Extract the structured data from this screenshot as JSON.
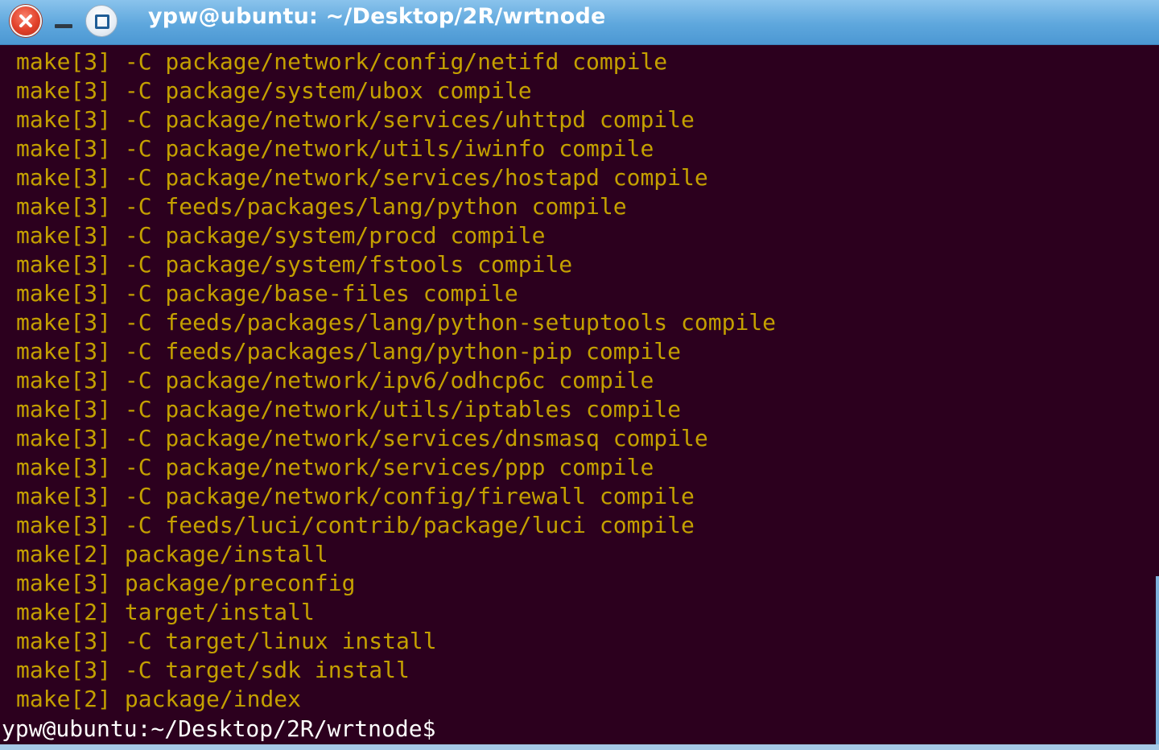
{
  "window": {
    "title": "ypw@ubuntu: ~/Desktop/2R/wrtnode",
    "controls": {
      "close_icon": "close-icon",
      "minimize_icon": "minimize-icon",
      "maximize_icon": "maximize-icon"
    }
  },
  "colors": {
    "background": "#2c001e",
    "output_text": "#c4a000",
    "prompt_text": "#ffffff",
    "titlebar": "#5ea7dd"
  },
  "terminal": {
    "lines": [
      "make[3] -C package/network/config/netifd compile",
      "make[3] -C package/system/ubox compile",
      "make[3] -C package/network/services/uhttpd compile",
      "make[3] -C package/network/utils/iwinfo compile",
      "make[3] -C package/network/services/hostapd compile",
      "make[3] -C feeds/packages/lang/python compile",
      "make[3] -C package/system/procd compile",
      "make[3] -C package/system/fstools compile",
      "make[3] -C package/base-files compile",
      "make[3] -C feeds/packages/lang/python-setuptools compile",
      "make[3] -C feeds/packages/lang/python-pip compile",
      "make[3] -C package/network/ipv6/odhcp6c compile",
      "make[3] -C package/network/utils/iptables compile",
      "make[3] -C package/network/services/dnsmasq compile",
      "make[3] -C package/network/services/ppp compile",
      "make[3] -C package/network/config/firewall compile",
      "make[3] -C feeds/luci/contrib/package/luci compile",
      "make[2] package/install",
      "make[3] package/preconfig",
      "make[2] target/install",
      "make[3] -C target/linux install",
      "make[3] -C target/sdk install",
      "make[2] package/index"
    ],
    "prompt": "ypw@ubuntu:~/Desktop/2R/wrtnode$"
  }
}
